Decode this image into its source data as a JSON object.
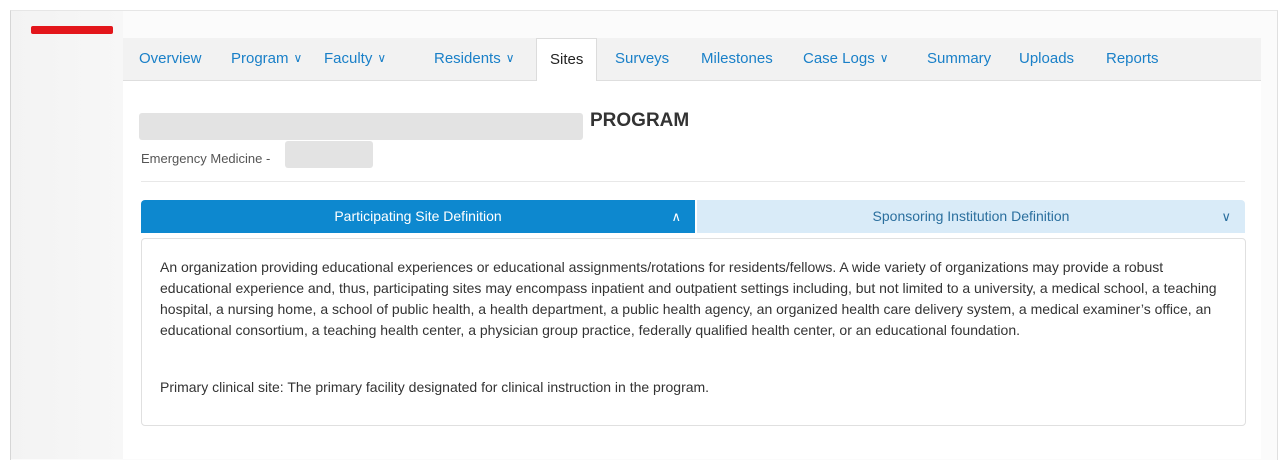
{
  "nav": {
    "items": [
      {
        "label": "Overview",
        "chevron": false
      },
      {
        "label": "Program",
        "chevron": true
      },
      {
        "label": "Faculty",
        "chevron": true
      },
      {
        "label": "Residents",
        "chevron": true
      },
      {
        "label": "Sites",
        "chevron": false,
        "active": true
      },
      {
        "label": "Surveys",
        "chevron": false
      },
      {
        "label": "Milestones",
        "chevron": false
      },
      {
        "label": "Case Logs",
        "chevron": true
      },
      {
        "label": "Summary",
        "chevron": false
      },
      {
        "label": "Uploads",
        "chevron": false
      },
      {
        "label": "Reports",
        "chevron": false
      }
    ],
    "chevron_glyph": "∨"
  },
  "header": {
    "title_suffix": "PROGRAM",
    "specialty_prefix": "Emergency Medicine -"
  },
  "accordion": {
    "tabs": [
      {
        "label": "Participating Site Definition",
        "chevron": "∧",
        "active": true
      },
      {
        "label": "Sponsoring Institution Definition",
        "chevron": "∨",
        "active": false
      }
    ],
    "paragraphs": [
      "An organization providing educational experiences or educational assignments/rotations for residents/fellows. A wide variety of organizations may provide a robust educational experience and, thus, participating sites may encompass inpatient and outpatient settings including, but not limited to a university, a medical school, a teaching hospital, a nursing home, a school of public health, a health department, a public health agency, an organized health care delivery system, a medical examiner’s office, an educational consortium, a teaching health center, a physician group practice, federally qualified health center, or an educational foundation.",
      "Primary clinical site: The primary facility designated for clinical instruction in the program."
    ]
  },
  "colors": {
    "accent": "#0d88cf",
    "link": "#1a80c8",
    "brand_red": "#e3161b",
    "inactive_tab": "#d9ebf8"
  }
}
